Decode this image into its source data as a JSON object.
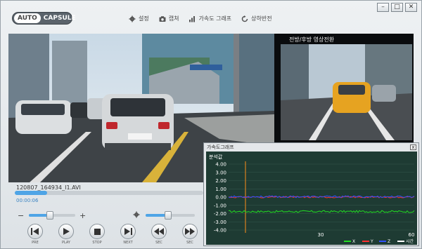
{
  "mode_toggle": {
    "auto": "AUTO",
    "capsule": "CAPSULE"
  },
  "toolbar": [
    {
      "label": "설정",
      "icon": "gear-icon"
    },
    {
      "label": "캡쳐",
      "icon": "camera-icon"
    },
    {
      "label": "가속도 그래프",
      "icon": "bar-chart-icon"
    },
    {
      "label": "상하반전",
      "icon": "rotate-icon"
    }
  ],
  "window_controls": {
    "minimize": "–",
    "maximize": "□",
    "close": "✕"
  },
  "side_view": {
    "caption": "전방/후방 영상전환"
  },
  "player": {
    "filename": "120807_164934_I1.AVI",
    "elapsed": "00:00:06",
    "progress": 0.17,
    "volume_minus": "−",
    "volume_plus": "+",
    "volume_level": 0.45,
    "brightness_level": 0.45
  },
  "controls": [
    {
      "label": "PRE",
      "icon": "skip-previous-icon"
    },
    {
      "label": "PLAY",
      "icon": "play-icon"
    },
    {
      "label": "STOP",
      "icon": "stop-icon"
    },
    {
      "label": "NEXT",
      "icon": "skip-next-icon"
    },
    {
      "label": "SEC",
      "icon": "rewind-icon"
    },
    {
      "label": "SEC",
      "icon": "fast-forward-icon"
    }
  ],
  "graph": {
    "title": "가속도그래프",
    "close": "x",
    "y_axis_label": "분석값",
    "y_ticks": [
      "4.00",
      "3.00",
      "2.00",
      "1.00",
      "0.00",
      "-1.00",
      "-2.00",
      "-3.00",
      "-4.00"
    ],
    "x_ticks": [
      "30",
      "60"
    ],
    "legend": [
      {
        "name": "X",
        "color": "#22dd22"
      },
      {
        "name": "Y",
        "color": "#ff3030"
      },
      {
        "name": "Z",
        "color": "#3050ff"
      },
      {
        "name": "시간",
        "color": "#ffffff"
      }
    ],
    "cursor_color": "#ff8c1a"
  }
}
